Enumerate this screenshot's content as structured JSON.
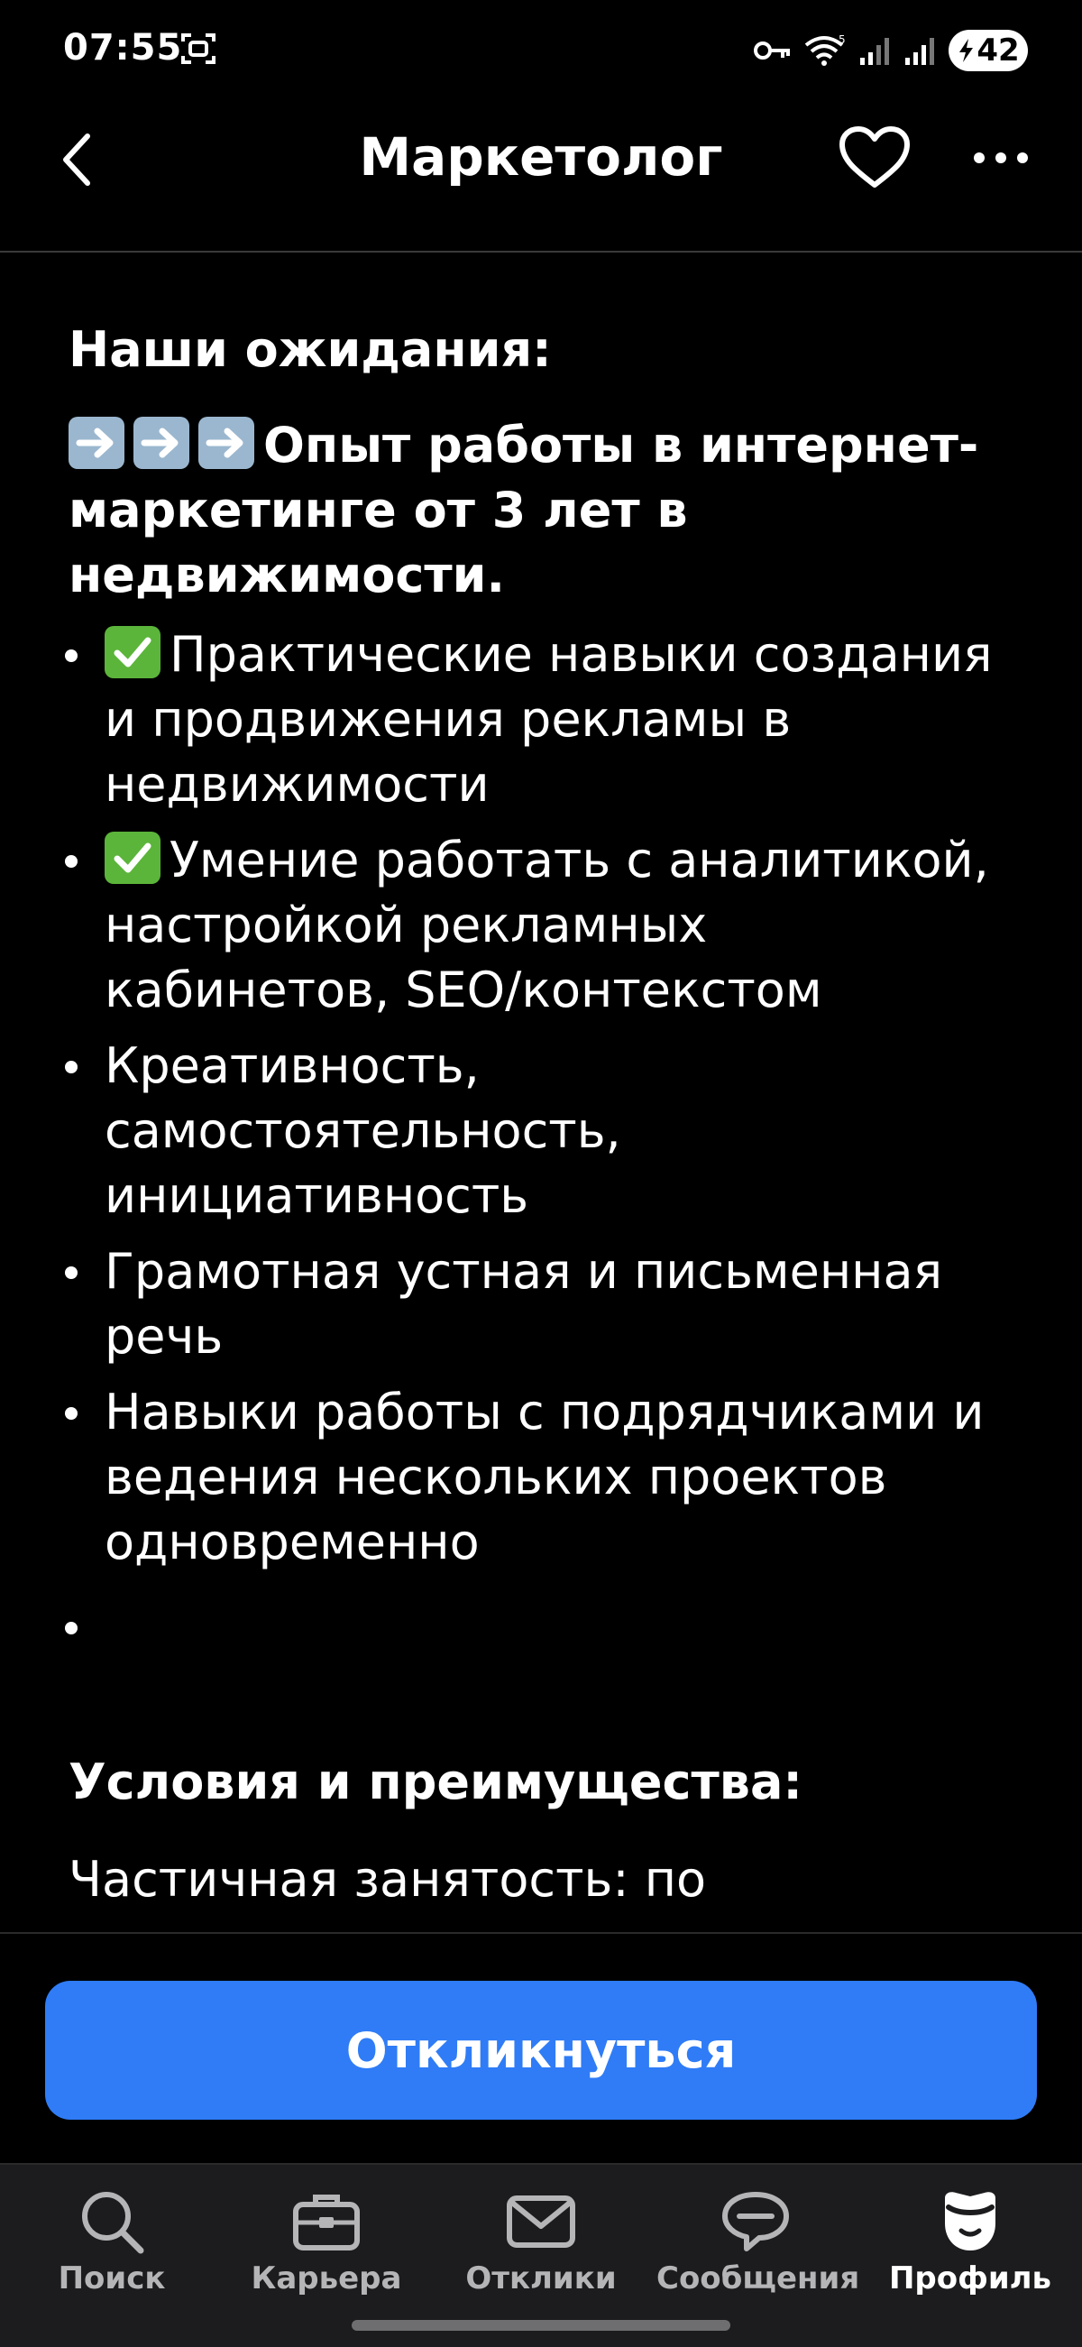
{
  "status_bar": {
    "time": "07:55",
    "battery": "42"
  },
  "header": {
    "title": "Маркетолог",
    "back_icon": "chevron-left-icon",
    "favorite_icon": "heart-icon",
    "more_icon": "more-dots-icon"
  },
  "content": {
    "expectations_heading": "Наши ожидания:",
    "lead_text": "Опыт работы в интернет-маркетинге от 3 лет в недвижимости.",
    "items": [
      {
        "check": true,
        "text": "Практические навыки создания и продвижения рекламы в недвижимости"
      },
      {
        "check": true,
        "text": "Умение работать с аналитикой, настройкой рекламных кабинетов, SEO/контекстом"
      },
      {
        "check": false,
        "text": "Креативность, самостоятельность, инициативность"
      },
      {
        "check": false,
        "text": "Грамотная устная и письменная речь"
      },
      {
        "check": false,
        "text": "Навыки работы с подрядчиками и ведения нескольких проектов одновременно"
      },
      {
        "check": false,
        "text": ""
      }
    ],
    "conditions_heading": "Условия и преимущества:",
    "conditions_first_line": "Частичная занятость: по"
  },
  "apply_button": {
    "label": "Откликнуться",
    "color": "#2f7cf6"
  },
  "bottom_nav": [
    {
      "label": "Поиск",
      "icon": "search-icon"
    },
    {
      "label": "Карьера",
      "icon": "briefcase-icon"
    },
    {
      "label": "Отклики",
      "icon": "envelope-icon"
    },
    {
      "label": "Сообщения",
      "icon": "chat-bubble-icon"
    },
    {
      "label": "Профиль",
      "icon": "profile-icon",
      "active": true
    }
  ]
}
